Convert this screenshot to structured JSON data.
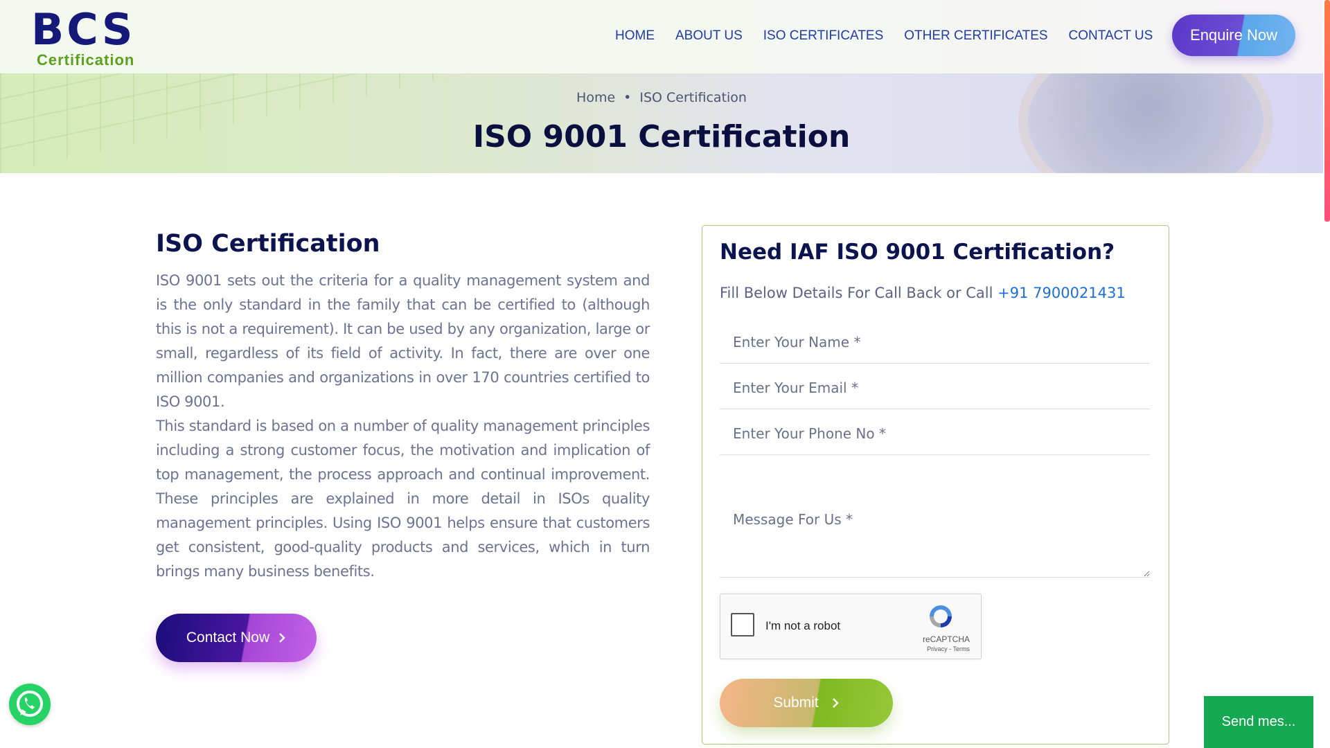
{
  "header": {
    "logo": {
      "mark": "BCS",
      "sub": "Certification"
    },
    "nav": [
      {
        "label": "HOME"
      },
      {
        "label": "ABOUT US"
      },
      {
        "label": "ISO CERTIFICATES"
      },
      {
        "label": "OTHER CERTIFICATES"
      },
      {
        "label": "CONTACT US"
      }
    ],
    "enquire_label": "Enquire Now"
  },
  "hero": {
    "breadcrumb_home": "Home",
    "breadcrumb_current": "ISO Certification",
    "title": "ISO 9001 Certification"
  },
  "main": {
    "section_title": "ISO Certification",
    "paragraph_1": "ISO 9001 sets out the criteria for a quality management system and is the only standard in the family that can be certified to (although this is not a requirement). It can be used by any organization, large or small, regardless of its field of activity. In fact, there are over one million companies and organizations in over 170 countries certified to ISO 9001.",
    "paragraph_2": "This standard is based on a number of quality management principles including a strong customer focus, the motivation and implication of top management, the process approach and continual improvement. These principles are explained in more detail in ISOs quality management principles. Using ISO 9001 helps ensure that customers get consistent, good-quality products and services, which in turn brings many business benefits.",
    "contact_label": "Contact Now"
  },
  "form": {
    "title": "Need IAF ISO 9001 Certification?",
    "subtitle": "Fill Below Details For Call Back or Call",
    "phone": "+91 7900021431",
    "name_placeholder": "Enter Your Name *",
    "email_placeholder": "Enter Your Email *",
    "phone_placeholder": "Enter Your Phone No *",
    "message_placeholder": "Message For Us *",
    "captcha_label": "I'm not a robot",
    "captcha_brand": "reCAPTCHA",
    "captcha_links": "Privacy - Terms",
    "submit_label": "Submit"
  },
  "chat": {
    "send_label": "Send mes..."
  },
  "icons": {
    "whatsapp": "whatsapp-icon",
    "recaptcha": "recaptcha-icon",
    "chevron": "chevron-right-icon"
  },
  "colors": {
    "brand_navy": "#15197a",
    "brand_green": "#5aa21e",
    "nav_blue": "#1f3ba8",
    "whatsapp_green": "#25d366",
    "chat_green": "#14a951"
  }
}
